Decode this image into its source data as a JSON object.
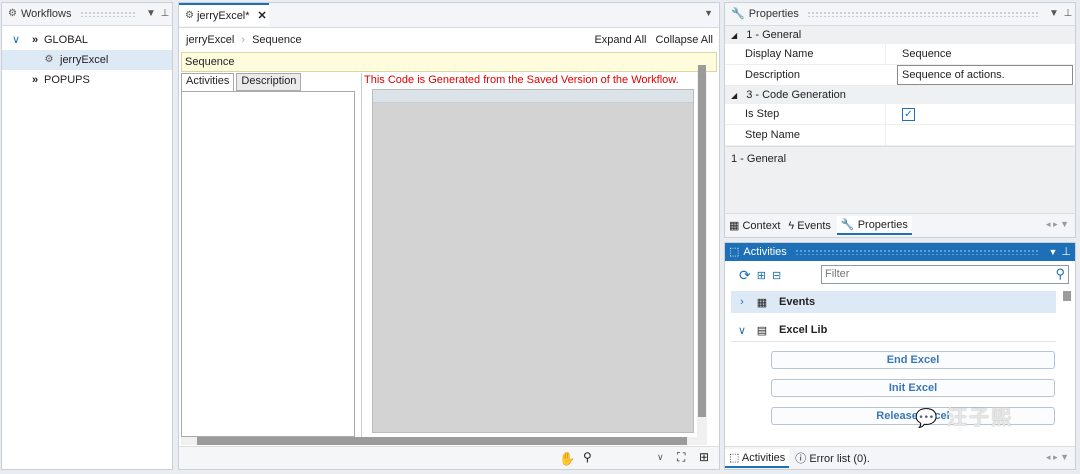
{
  "workflows": {
    "title": "Workflows",
    "items": [
      {
        "label": "GLOBAL"
      },
      {
        "label": "jerryExcel"
      },
      {
        "label": "POPUPS"
      }
    ]
  },
  "editor": {
    "tab_label": "jerryExcel*",
    "breadcrumb": [
      "jerryExcel",
      "Sequence"
    ],
    "expand_all": "Expand All",
    "collapse_all": "Collapse All",
    "sequence_label": "Sequence",
    "subtabs": [
      "Activities",
      "Description"
    ],
    "generated_notice": "This Code is Generated from the Saved Version of the Workflow."
  },
  "properties": {
    "title": "Properties",
    "sections": [
      {
        "header": "1 - General",
        "rows": [
          {
            "name": "Display Name",
            "value": "Sequence"
          },
          {
            "name": "Description",
            "value": "Sequence of actions."
          }
        ]
      },
      {
        "header": "3 - Code Generation",
        "rows": [
          {
            "name": "Is Step",
            "value": ""
          },
          {
            "name": "Step Name",
            "value": ""
          }
        ]
      }
    ],
    "help_text": "1 - General",
    "bottom_tabs": [
      "Context",
      "Events",
      "Properties"
    ]
  },
  "activities": {
    "title": "Activities",
    "filter_placeholder": "Filter",
    "groups": [
      {
        "label": "Events",
        "expanded": false
      },
      {
        "label": "Excel Lib",
        "expanded": true,
        "items": [
          "End Excel",
          "Init Excel",
          "Release Excel"
        ]
      }
    ],
    "bottom_tabs": [
      "Activities",
      "Error list (0)."
    ]
  },
  "watermark": "汪子熙",
  "colors": {
    "accent": "#1d6fb8",
    "notice": "#e00000",
    "sequence_bg": "#fffbdd"
  }
}
